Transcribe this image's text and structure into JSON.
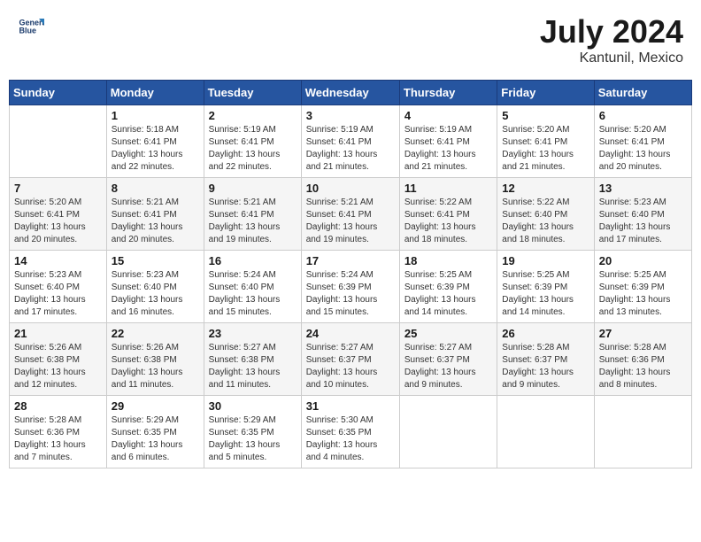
{
  "header": {
    "logo_line1": "General",
    "logo_line2": "Blue",
    "month_title": "July 2024",
    "subtitle": "Kantunil, Mexico"
  },
  "days_of_week": [
    "Sunday",
    "Monday",
    "Tuesday",
    "Wednesday",
    "Thursday",
    "Friday",
    "Saturday"
  ],
  "weeks": [
    [
      {
        "day": "",
        "info": ""
      },
      {
        "day": "1",
        "info": "Sunrise: 5:18 AM\nSunset: 6:41 PM\nDaylight: 13 hours\nand 22 minutes."
      },
      {
        "day": "2",
        "info": "Sunrise: 5:19 AM\nSunset: 6:41 PM\nDaylight: 13 hours\nand 22 minutes."
      },
      {
        "day": "3",
        "info": "Sunrise: 5:19 AM\nSunset: 6:41 PM\nDaylight: 13 hours\nand 21 minutes."
      },
      {
        "day": "4",
        "info": "Sunrise: 5:19 AM\nSunset: 6:41 PM\nDaylight: 13 hours\nand 21 minutes."
      },
      {
        "day": "5",
        "info": "Sunrise: 5:20 AM\nSunset: 6:41 PM\nDaylight: 13 hours\nand 21 minutes."
      },
      {
        "day": "6",
        "info": "Sunrise: 5:20 AM\nSunset: 6:41 PM\nDaylight: 13 hours\nand 20 minutes."
      }
    ],
    [
      {
        "day": "7",
        "info": ""
      },
      {
        "day": "8",
        "info": "Sunrise: 5:21 AM\nSunset: 6:41 PM\nDaylight: 13 hours\nand 20 minutes."
      },
      {
        "day": "9",
        "info": "Sunrise: 5:21 AM\nSunset: 6:41 PM\nDaylight: 13 hours\nand 19 minutes."
      },
      {
        "day": "10",
        "info": "Sunrise: 5:21 AM\nSunset: 6:41 PM\nDaylight: 13 hours\nand 19 minutes."
      },
      {
        "day": "11",
        "info": "Sunrise: 5:22 AM\nSunset: 6:41 PM\nDaylight: 13 hours\nand 18 minutes."
      },
      {
        "day": "12",
        "info": "Sunrise: 5:22 AM\nSunset: 6:40 PM\nDaylight: 13 hours\nand 18 minutes."
      },
      {
        "day": "13",
        "info": "Sunrise: 5:23 AM\nSunset: 6:40 PM\nDaylight: 13 hours\nand 17 minutes."
      }
    ],
    [
      {
        "day": "14",
        "info": ""
      },
      {
        "day": "15",
        "info": "Sunrise: 5:23 AM\nSunset: 6:40 PM\nDaylight: 13 hours\nand 16 minutes."
      },
      {
        "day": "16",
        "info": "Sunrise: 5:24 AM\nSunset: 6:40 PM\nDaylight: 13 hours\nand 15 minutes."
      },
      {
        "day": "17",
        "info": "Sunrise: 5:24 AM\nSunset: 6:39 PM\nDaylight: 13 hours\nand 15 minutes."
      },
      {
        "day": "18",
        "info": "Sunrise: 5:25 AM\nSunset: 6:39 PM\nDaylight: 13 hours\nand 14 minutes."
      },
      {
        "day": "19",
        "info": "Sunrise: 5:25 AM\nSunset: 6:39 PM\nDaylight: 13 hours\nand 14 minutes."
      },
      {
        "day": "20",
        "info": "Sunrise: 5:25 AM\nSunset: 6:39 PM\nDaylight: 13 hours\nand 13 minutes."
      }
    ],
    [
      {
        "day": "21",
        "info": ""
      },
      {
        "day": "22",
        "info": "Sunrise: 5:26 AM\nSunset: 6:38 PM\nDaylight: 13 hours\nand 11 minutes."
      },
      {
        "day": "23",
        "info": "Sunrise: 5:27 AM\nSunset: 6:38 PM\nDaylight: 13 hours\nand 11 minutes."
      },
      {
        "day": "24",
        "info": "Sunrise: 5:27 AM\nSunset: 6:37 PM\nDaylight: 13 hours\nand 10 minutes."
      },
      {
        "day": "25",
        "info": "Sunrise: 5:27 AM\nSunset: 6:37 PM\nDaylight: 13 hours\nand 9 minutes."
      },
      {
        "day": "26",
        "info": "Sunrise: 5:28 AM\nSunset: 6:37 PM\nDaylight: 13 hours\nand 9 minutes."
      },
      {
        "day": "27",
        "info": "Sunrise: 5:28 AM\nSunset: 6:36 PM\nDaylight: 13 hours\nand 8 minutes."
      }
    ],
    [
      {
        "day": "28",
        "info": "Sunrise: 5:28 AM\nSunset: 6:36 PM\nDaylight: 13 hours\nand 7 minutes."
      },
      {
        "day": "29",
        "info": "Sunrise: 5:29 AM\nSunset: 6:35 PM\nDaylight: 13 hours\nand 6 minutes."
      },
      {
        "day": "30",
        "info": "Sunrise: 5:29 AM\nSunset: 6:35 PM\nDaylight: 13 hours\nand 5 minutes."
      },
      {
        "day": "31",
        "info": "Sunrise: 5:30 AM\nSunset: 6:35 PM\nDaylight: 13 hours\nand 4 minutes."
      },
      {
        "day": "",
        "info": ""
      },
      {
        "day": "",
        "info": ""
      },
      {
        "day": "",
        "info": ""
      }
    ]
  ],
  "week1_sunday_info": "Sunrise: 5:20 AM\nSunset: 6:41 PM\nDaylight: 13 hours\nand 20 minutes.",
  "week2_sunday_info": "Sunrise: 5:20 AM\nSunset: 6:41 PM\nDaylight: 13 hours\nand 20 minutes.",
  "week3_sunday_info": "Sunrise: 5:23 AM\nSunset: 6:40 PM\nDaylight: 13 hours\nand 17 minutes.",
  "week4_sunday_info": "Sunrise: 5:26 AM\nSunset: 6:38 PM\nDaylight: 13 hours\nand 12 minutes."
}
